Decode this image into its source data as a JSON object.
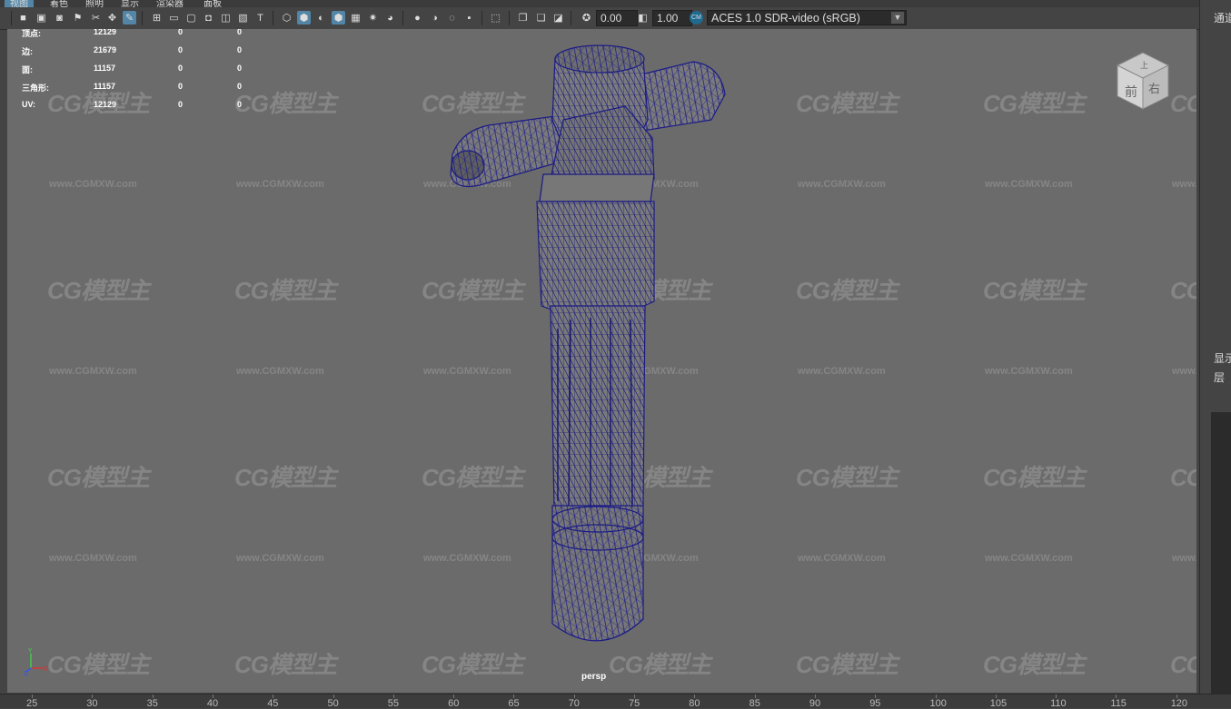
{
  "menu": [
    "视图",
    "着色",
    "照明",
    "显示",
    "渲染器",
    "面板"
  ],
  "toolbar": {
    "gamma_value": "0.00",
    "exposure_value": "1.00",
    "colorspace": "ACES 1.0 SDR-video (sRGB)",
    "colorspace_badge": "CM"
  },
  "hud": {
    "rows": [
      {
        "label": "顶点:",
        "total": "12129",
        "sel": "0",
        "comp": "0"
      },
      {
        "label": "边:",
        "total": "21679",
        "sel": "0",
        "comp": "0"
      },
      {
        "label": "面:",
        "total": "11157",
        "sel": "0",
        "comp": "0"
      },
      {
        "label": "三角形:",
        "total": "11157",
        "sel": "0",
        "comp": "0"
      },
      {
        "label": "UV:",
        "total": "12129",
        "sel": "0",
        "comp": "0"
      }
    ]
  },
  "viewcube": {
    "top": "上",
    "front": "前",
    "right": "右"
  },
  "axis": {
    "y": "Y",
    "x": "X",
    "z": "Z"
  },
  "camera": "persp",
  "watermark": {
    "logo": "CG模型主",
    "url": "www.CGMXW.com"
  },
  "right_panel": {
    "channels": "通道",
    "display": "显示",
    "layers": "层"
  },
  "timeline_ticks": [
    "25",
    "30",
    "35",
    "40",
    "45",
    "50",
    "55",
    "60",
    "65",
    "70",
    "75",
    "80",
    "85",
    "90",
    "95",
    "100",
    "105",
    "110",
    "115",
    "120"
  ]
}
